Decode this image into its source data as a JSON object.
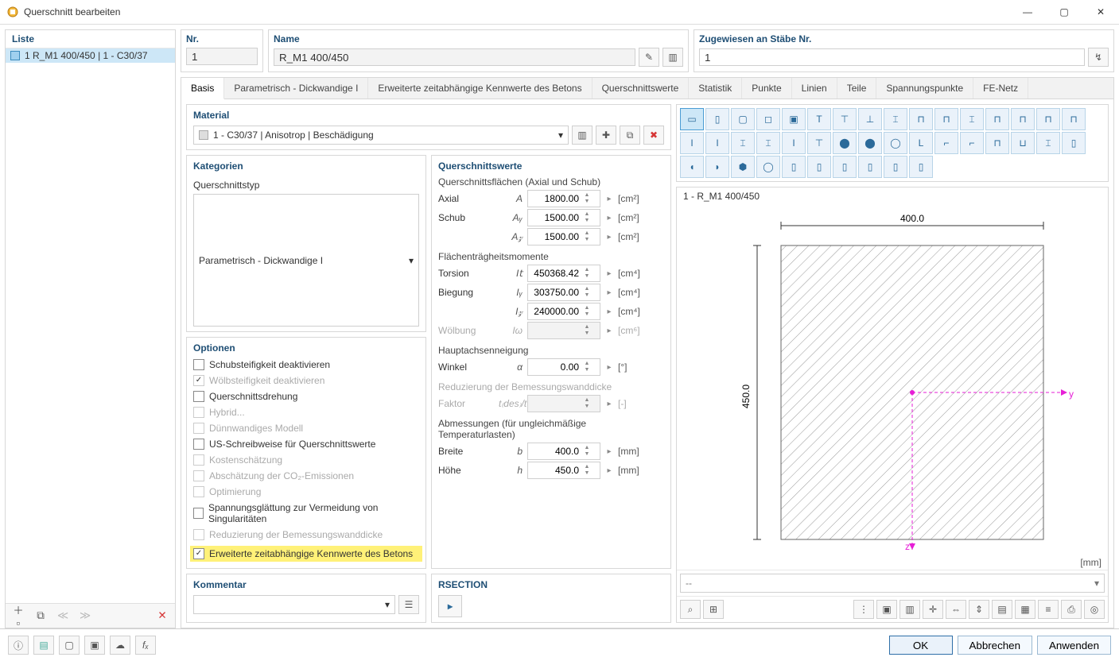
{
  "window": {
    "title": "Querschnitt bearbeiten"
  },
  "win_controls": {
    "min": "—",
    "max": "▢",
    "close": "✕"
  },
  "list": {
    "header": "Liste",
    "items": [
      {
        "text": "1  R_M1 400/450 | 1 - C30/37"
      }
    ],
    "toolbar": {
      "new": "＋▫",
      "dup": "⧉",
      "prev": "≪",
      "next": "≫",
      "del": "✕"
    }
  },
  "fields": {
    "nr_label": "Nr.",
    "nr_value": "1",
    "name_label": "Name",
    "name_value": "R_M1 400/450",
    "assign_label": "Zugewiesen an Stäbe Nr.",
    "assign_value": "1",
    "edit_icon": "✎",
    "lib_icon": "▥",
    "pick_icon": "↯"
  },
  "tabs": [
    "Basis",
    "Parametrisch - Dickwandige I",
    "Erweiterte zeitabhängige Kennwerte des Betons",
    "Querschnittswerte",
    "Statistik",
    "Punkte",
    "Linien",
    "Teile",
    "Spannungspunkte",
    "FE-Netz"
  ],
  "material": {
    "title": "Material",
    "value": "1 - C30/37 | Anisotrop | Beschädigung",
    "icons": {
      "lib": "▥",
      "new": "✚",
      "dup": "⧉",
      "del": "✖"
    }
  },
  "categories": {
    "title": "Kategorien",
    "type_label": "Querschnittstyp",
    "type_value": "Parametrisch - Dickwandige I"
  },
  "options": {
    "title": "Optionen",
    "items": [
      {
        "label": "Schubsteifigkeit deaktivieren",
        "checked": false,
        "disabled": false
      },
      {
        "label": "Wölbsteifigkeit deaktivieren",
        "checked": true,
        "disabled": true
      },
      {
        "label": "Querschnittsdrehung",
        "checked": false,
        "disabled": false
      },
      {
        "label": "Hybrid...",
        "checked": false,
        "disabled": true
      },
      {
        "label": "Dünnwandiges Modell",
        "checked": false,
        "disabled": true
      },
      {
        "label": "US-Schreibweise für Querschnittswerte",
        "checked": false,
        "disabled": false
      },
      {
        "label": "Kostenschätzung",
        "checked": false,
        "disabled": true
      },
      {
        "label": "Abschätzung der CO₂-Emissionen",
        "checked": false,
        "disabled": true
      },
      {
        "label": "Optimierung",
        "checked": false,
        "disabled": true
      },
      {
        "label": "Spannungsglättung zur Vermeidung von Singularitäten",
        "checked": false,
        "disabled": false
      },
      {
        "label": "Reduzierung der Bemessungswanddicke",
        "checked": false,
        "disabled": true
      },
      {
        "label": "Erweiterte zeitabhängige Kennwerte des Betons",
        "checked": true,
        "disabled": false,
        "highlight": true
      }
    ]
  },
  "qvalues": {
    "title": "Querschnittswerte",
    "areas_head": "Querschnittsflächen (Axial und Schub)",
    "rows_area": [
      {
        "label": "Axial",
        "sym": "A",
        "val": "1800.00",
        "unit": "[cm²]"
      },
      {
        "label": "Schub",
        "sym": "Aᵧ",
        "val": "1500.00",
        "unit": "[cm²]"
      },
      {
        "label": "",
        "sym": "A𝓏",
        "val": "1500.00",
        "unit": "[cm²]"
      }
    ],
    "inertia_head": "Flächenträgheitsmomente",
    "rows_inertia": [
      {
        "label": "Torsion",
        "sym": "I𝗍",
        "val": "450368.42",
        "unit": "[cm⁴]"
      },
      {
        "label": "Biegung",
        "sym": "Iᵧ",
        "val": "303750.00",
        "unit": "[cm⁴]"
      },
      {
        "label": "",
        "sym": "I𝓏",
        "val": "240000.00",
        "unit": "[cm⁴]"
      },
      {
        "label": "Wölbung",
        "sym": "Iω",
        "val": "",
        "unit": "[cm⁶]",
        "disabled": true
      }
    ],
    "axis_head": "Hauptachsenneigung",
    "rows_axis": [
      {
        "label": "Winkel",
        "sym": "α",
        "val": "0.00",
        "unit": "[°]"
      }
    ],
    "red_head": "Reduzierung der Bemessungswanddicke",
    "rows_red": [
      {
        "label": "Faktor",
        "sym": "t₍des₎/t",
        "val": "",
        "unit": "[-]",
        "disabled": true
      }
    ],
    "dim_head": "Abmessungen (für ungleichmäßige Temperaturlasten)",
    "rows_dim": [
      {
        "label": "Breite",
        "sym": "b",
        "val": "400.0",
        "unit": "[mm]"
      },
      {
        "label": "Höhe",
        "sym": "h",
        "val": "450.0",
        "unit": "[mm]"
      }
    ]
  },
  "comment": {
    "title": "Kommentar",
    "value": ""
  },
  "rsection": {
    "title": "RSECTION",
    "icon": "▸"
  },
  "shapes": [
    "▭",
    "▯",
    "▢",
    "◻",
    "▣",
    "T",
    "⊤",
    "⊥",
    "⌶",
    "⊓",
    "⊓",
    "⌶",
    "⊓",
    "⊓",
    "⊓",
    "⊓",
    "I",
    "I",
    "⌶",
    "⌶",
    "I",
    "⊤",
    "⬤",
    "⬤",
    "◯",
    "L",
    "⌐",
    "⌐",
    "⊓",
    "⊔",
    "⌶",
    "▯",
    "◖",
    "◗",
    "⬢",
    "◯",
    "▯",
    "▯",
    "▯",
    "▯",
    "▯",
    "▯"
  ],
  "preview": {
    "title": "1 - R_M1 400/450",
    "width_label": "400.0",
    "height_label": "450.0",
    "y": "y",
    "z": "z",
    "unit": "[mm]",
    "footer_sel": "--"
  },
  "statusbar": {
    "ok": "OK",
    "cancel": "Abbrechen",
    "apply": "Anwenden"
  },
  "glyphs": {
    "chev": "▾",
    "chev_up": "▴",
    "chev_r": "▸",
    "plus": "＋"
  }
}
